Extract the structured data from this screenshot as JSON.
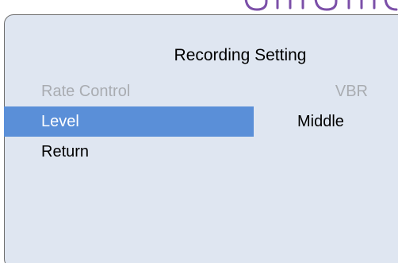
{
  "dialog": {
    "title": "Recording Setting",
    "items": [
      {
        "label": "Rate Control",
        "value": "VBR",
        "state": "disabled"
      },
      {
        "label": "Level",
        "value": "Middle",
        "state": "selected"
      },
      {
        "label": "Return",
        "value": "",
        "state": "normal"
      }
    ]
  },
  "colors": {
    "panel_background": "#dfe6f1",
    "selection_highlight": "#5a8fd8",
    "disabled_text": "#a9acb1",
    "heading_glyphs": "#7b4fa8"
  }
}
